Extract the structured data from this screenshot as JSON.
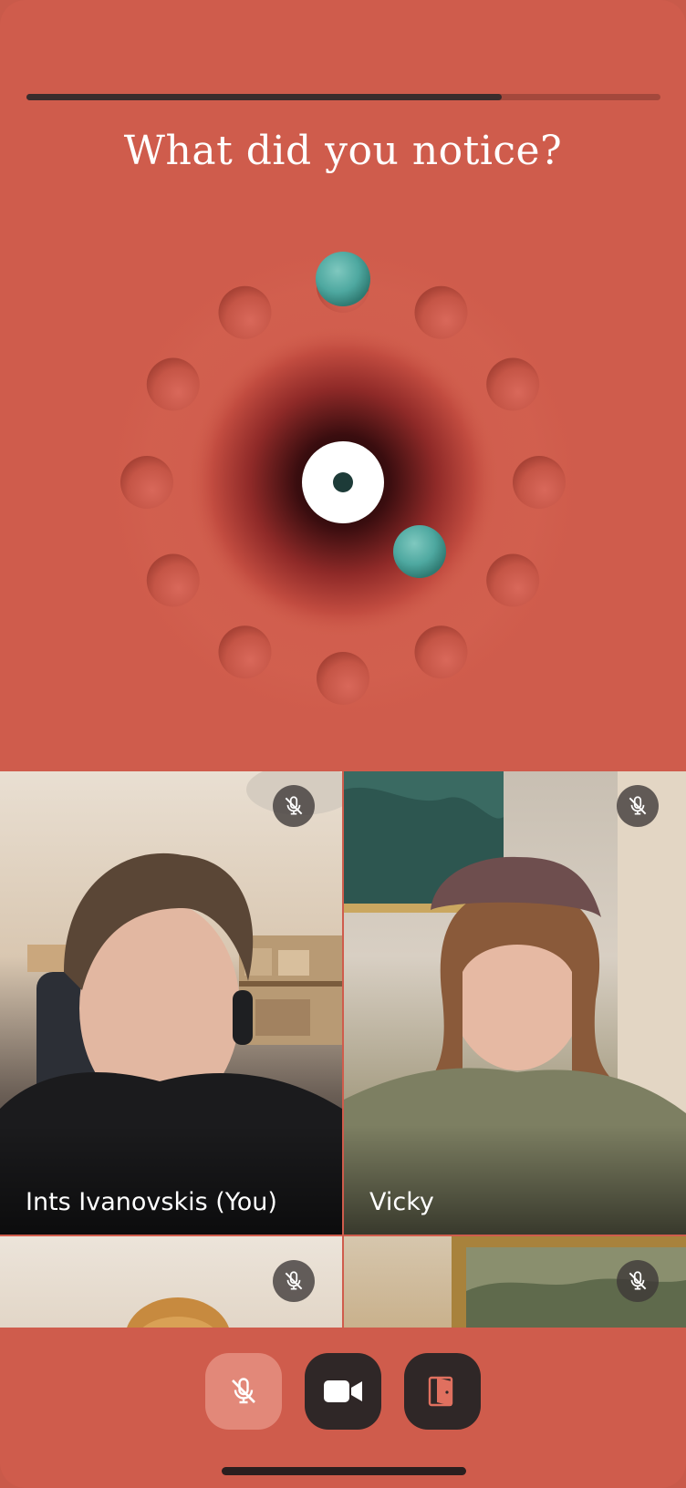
{
  "progress": {
    "fraction": 0.75
  },
  "question": {
    "title": "What did you notice?"
  },
  "board": {
    "hole_count": 12,
    "marbles": [
      {
        "color": "#4ea8a0",
        "position": "top-hole"
      },
      {
        "color": "#4ea8a0",
        "position": "near-center"
      }
    ],
    "colors": {
      "background": "#cf5c4c",
      "center_ring": "#ffffff",
      "center_dot": "#1d3b38"
    }
  },
  "participants": [
    {
      "name": "Ints Ivanovskis (You)",
      "muted": true
    },
    {
      "name": "Vicky",
      "muted": true
    },
    {
      "name": "",
      "muted": true
    },
    {
      "name": "",
      "muted": true
    }
  ],
  "controls": {
    "mic": {
      "icon": "mic-off-icon",
      "state": "muted"
    },
    "camera": {
      "icon": "video-camera-icon",
      "state": "on"
    },
    "leave": {
      "icon": "door-exit-icon"
    }
  },
  "colors": {
    "accent": "#cf5c4c",
    "dark_button": "#2f2727",
    "mic_button": "#e28879",
    "progress_fill": "#3a2c2c",
    "marble": "#4ea8a0"
  }
}
